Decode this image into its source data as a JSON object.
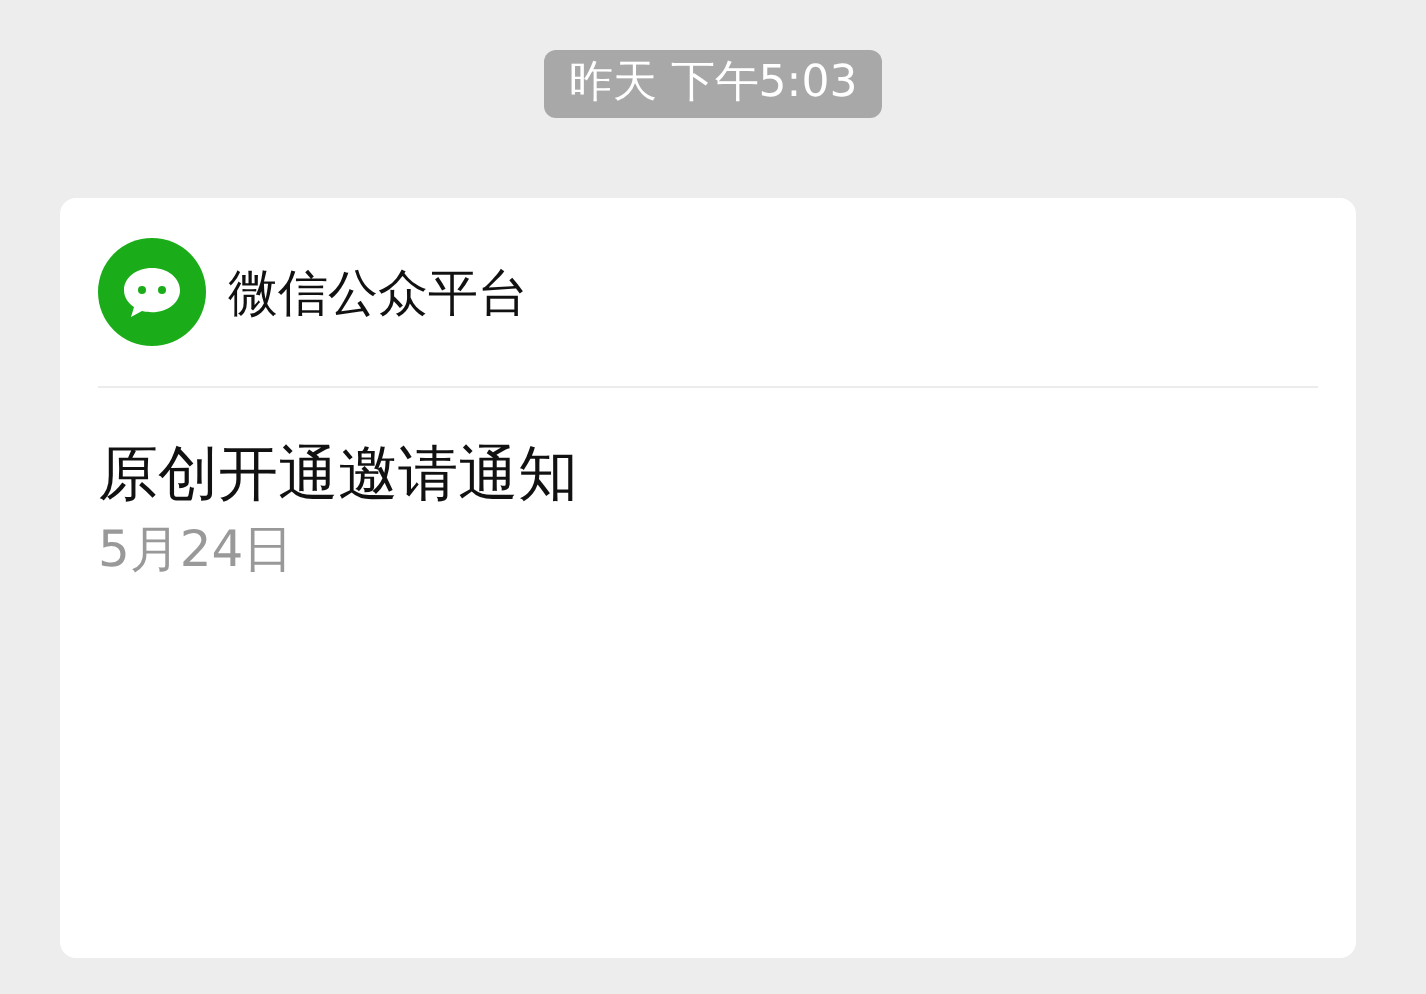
{
  "timestamp": "昨天 下午5:03",
  "card": {
    "account_name": "微信公众平台",
    "title": "原创开通邀请通知",
    "date": "5月24日"
  }
}
